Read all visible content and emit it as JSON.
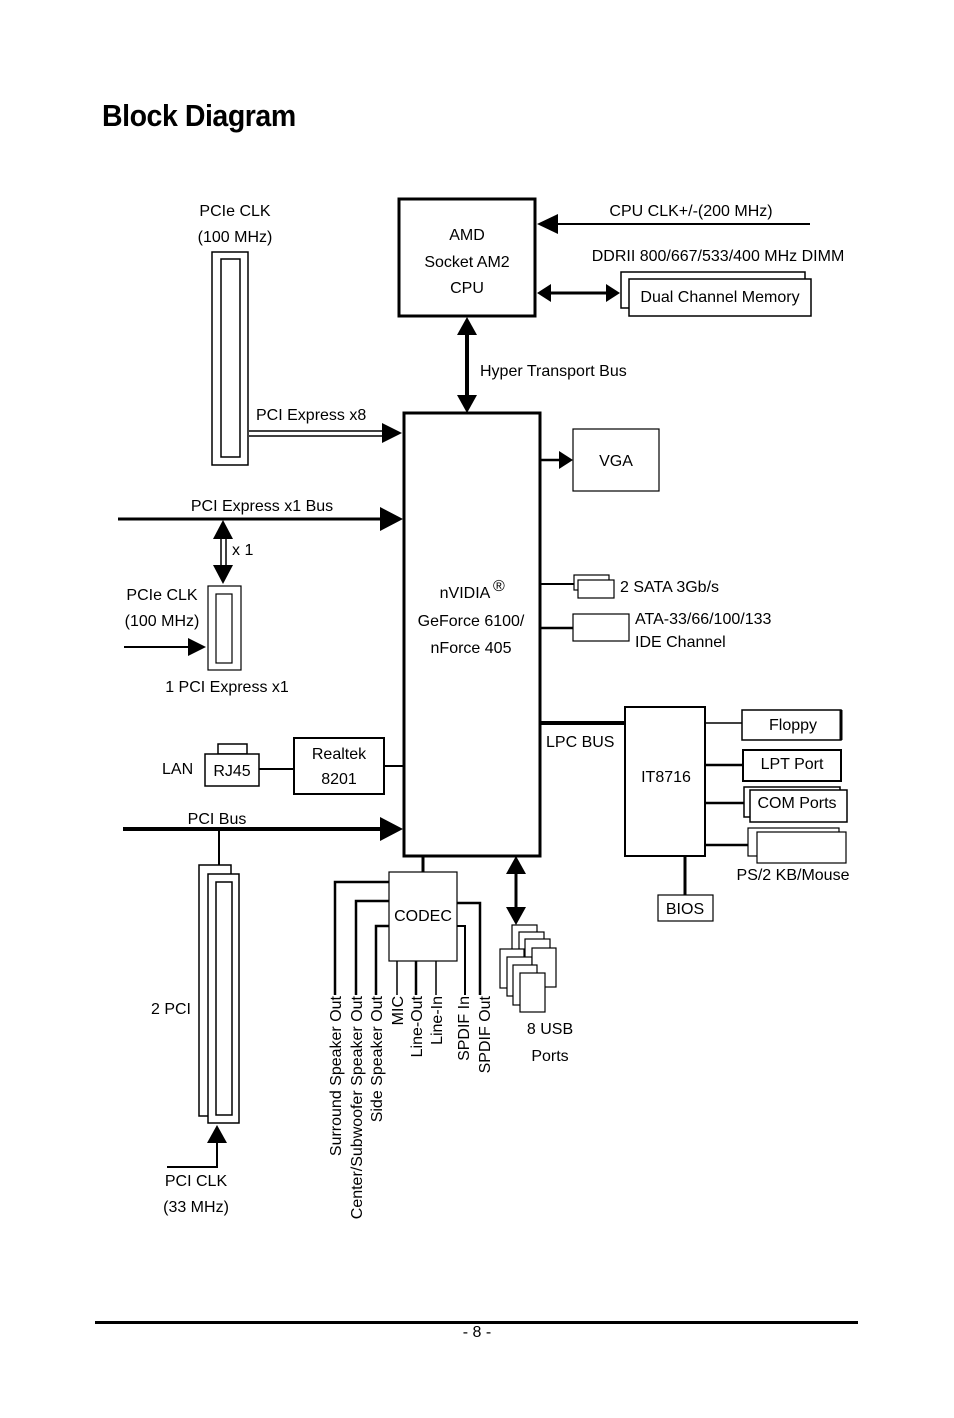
{
  "page": {
    "title": "Block Diagram",
    "page_number": "- 8 -"
  },
  "cpu": {
    "lines": [
      "AMD",
      "Socket AM2",
      "CPU"
    ],
    "clock_label": "CPU CLK+/-(200 MHz)",
    "dimm_label": "DDRII 800/667/533/400 MHz DIMM",
    "memory_label": "Dual Channel Memory",
    "bus_label": "Hyper Transport Bus"
  },
  "chipset": {
    "lines": [
      "nVIDIA",
      "GeForce 6100/",
      "nForce 405"
    ],
    "trademark": "®"
  },
  "pcie_x8": {
    "clk_lines": [
      "PCIe CLK",
      "(100 MHz)"
    ],
    "label": "PCI Express x8"
  },
  "pcie_x1": {
    "bus_label": "PCI Express x1 Bus",
    "link_label": "x 1",
    "clk_lines": [
      "PCIe CLK",
      "(100 MHz)"
    ],
    "slot_label": "1 PCI Express x1"
  },
  "lan": {
    "label": "LAN",
    "connector": "RJ45",
    "phy_lines": [
      "Realtek",
      "8201"
    ]
  },
  "pci": {
    "bus_label": "PCI Bus",
    "slots_label": "2 PCI",
    "clk_lines": [
      "PCI CLK",
      "(33 MHz)"
    ]
  },
  "right_side": {
    "vga": "VGA",
    "sata": "2 SATA 3Gb/s",
    "ide_lines": [
      "ATA-33/66/100/133",
      "IDE Channel"
    ],
    "lpc_label": "LPC BUS"
  },
  "superio": {
    "chip": "IT8716",
    "bios": "BIOS",
    "ports": [
      "Floppy",
      "LPT Port",
      "COM Ports"
    ],
    "ps2_label": "PS/2 KB/Mouse"
  },
  "audio": {
    "codec": "CODEC",
    "outputs": [
      "Surround Speaker Out",
      "Center/Subwoofer Speaker Out",
      "Side Speaker Out",
      "MIC",
      "Line-Out",
      "Line-In",
      "SPDIF In",
      "SPDIF Out"
    ]
  },
  "usb": {
    "lines": [
      "8 USB",
      "Ports"
    ]
  }
}
